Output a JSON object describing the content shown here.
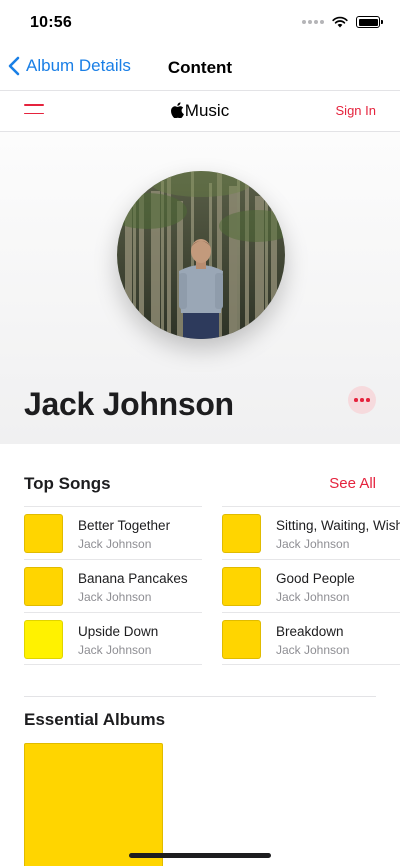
{
  "status_bar": {
    "time": "10:56"
  },
  "nav": {
    "back_label": "Album Details",
    "title": "Content"
  },
  "music_header": {
    "logo_text": "Music",
    "sign_in_label": "Sign In"
  },
  "artist": {
    "name": "Jack Johnson"
  },
  "top_songs": {
    "title": "Top Songs",
    "see_all_label": "See All",
    "left": [
      {
        "title": "Better Together",
        "artist": "Jack Johnson",
        "art_color": "#ffd500"
      },
      {
        "title": "Banana Pancakes",
        "artist": "Jack Johnson",
        "art_color": "#ffd500"
      },
      {
        "title": "Upside Down",
        "artist": "Jack Johnson",
        "art_color": "#fff200"
      }
    ],
    "right": [
      {
        "title": "Sitting, Waiting, Wishing",
        "artist": "Jack Johnson",
        "art_color": "#ffd500"
      },
      {
        "title": "Good People",
        "artist": "Jack Johnson",
        "art_color": "#ffd500"
      },
      {
        "title": "Breakdown",
        "artist": "Jack Johnson",
        "art_color": "#ffd500"
      }
    ]
  },
  "essential_albums": {
    "title": "Essential Albums"
  },
  "colors": {
    "accent_red": "#e5233d",
    "link_blue": "#1a7fe6",
    "album_yellow": "#ffd500"
  }
}
